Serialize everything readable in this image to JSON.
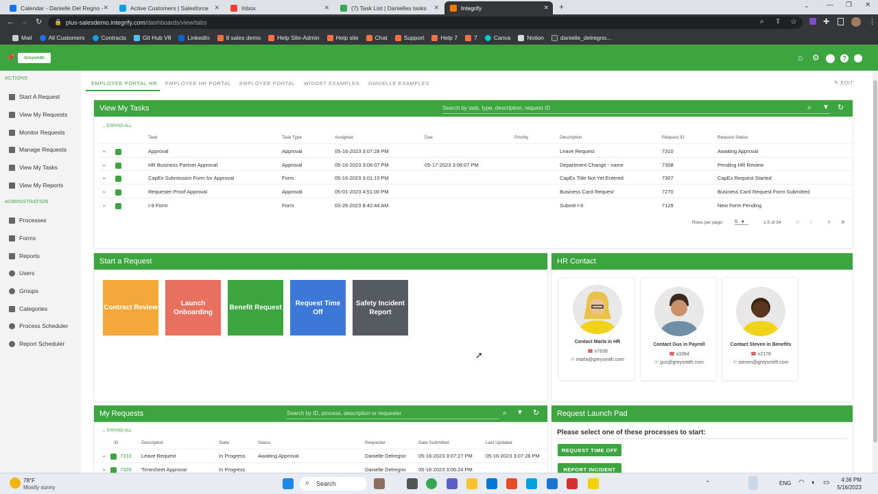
{
  "browser": {
    "tabs": [
      {
        "label": "Calendar - Danielle Del Regno -",
        "color": "#1a73e8"
      },
      {
        "label": "Active Customers | Salesforce",
        "color": "#00a1e0"
      },
      {
        "label": "Inbox",
        "color": "#ea4335"
      },
      {
        "label": "(7) Task List | Danielles tasks",
        "color": "#34a853"
      },
      {
        "label": "Integrify",
        "color": "#f57c00"
      }
    ],
    "url_host": "plus-salesdemo.integrify.com",
    "url_path": "/dashboards/view/tabs",
    "bookmarks": [
      "Mail",
      "All Customers",
      "Contracts",
      "Git Hub V8",
      "LinkedIn",
      "8 sales demo",
      "Help Site-Admin",
      "Help site",
      "Chat",
      "Support",
      "Help 7",
      "7",
      "Canva",
      "Notion",
      "danielle_delregno..."
    ]
  },
  "app": {
    "logo": "Greysmith"
  },
  "sidebar": {
    "actions_heading": "ACTIONS",
    "actions": [
      "Start A Request",
      "View My Requests",
      "Monitor Requests",
      "Manage Requests",
      "View My Tasks",
      "View My Reports"
    ],
    "admin_heading": "ADMINISTRATION",
    "admin": [
      "Processes",
      "Forms",
      "Reports",
      "Users",
      "Groups",
      "Categories",
      "Process Scheduler",
      "Report Scheduler"
    ]
  },
  "portal_tabs": [
    "EMPLOYEE PORTAL HR",
    "EMPLOYEE HR PORTAL",
    "EMPLOYEE PORTAL",
    "WIDGET EXAMPLES",
    "DANIELLE EXAMPLES"
  ],
  "edit_label": "EDIT",
  "tasks": {
    "title": "View My Tasks",
    "search_placeholder": "Search by task, type, description, request ID",
    "expand_all": "EXPAND ALL",
    "columns": [
      "Task",
      "Task Type",
      "Assigned",
      "Due",
      "Priority",
      "Description",
      "Request ID",
      "Request Status"
    ],
    "rows": [
      [
        "Approval",
        "Approval",
        "05-16-2023 3:07:28 PM",
        "",
        "",
        "Leave Request",
        "7310",
        "Awaiting Approval"
      ],
      [
        "HR Business Partner Approval",
        "Approval",
        "05-16-2023 3:06:07 PM",
        "05-17-2023 3:06:07 PM",
        "",
        "Department Change - name",
        "7308",
        "Pending HR Review"
      ],
      [
        "CapEx Submission Form for Approval",
        "Form",
        "05-16-2023 3:01:15 PM",
        "",
        "",
        "CapEx Title Not Yet Entered",
        "7307",
        "CapEx Request Started"
      ],
      [
        "Requester Proof Approval",
        "Approval",
        "05-01-2023 4:51:00 PM",
        "",
        "",
        "Business Card Request",
        "7270",
        "Business Card Request Form Submitted"
      ],
      [
        "I-9 Form",
        "Form",
        "03-26-2023 8:42:44 AM",
        "",
        "",
        "Submit I-9",
        "7129",
        "New Form Pending"
      ]
    ],
    "rows_per_page_label": "Rows per page:",
    "rows_per_page": "5",
    "range": "1-5 of 34"
  },
  "start_request": {
    "title": "Start a Request",
    "tiles": [
      {
        "label": "Contract Review",
        "color": "#f5a83a"
      },
      {
        "label": "Launch Onboarding",
        "color": "#e8705e"
      },
      {
        "label": "Benefit Request",
        "color": "#3da53f"
      },
      {
        "label": "Request Time Off",
        "color": "#3b78d8"
      },
      {
        "label": "Safety Incident Report",
        "color": "#555b61"
      }
    ]
  },
  "hr_contact": {
    "title": "HR Contact",
    "contacts": [
      {
        "name": "Contact Marla in HR",
        "ext": "x7639",
        "email": "marla@greysmith.com"
      },
      {
        "name": "Contact Gus in Payroll",
        "ext": "x3364",
        "email": "gus@greysmith.com"
      },
      {
        "name": "Contact Steven in Benefits",
        "ext": "x2178",
        "email": "steven@greysmith.com"
      }
    ]
  },
  "my_requests": {
    "title": "My Requests",
    "search_placeholder": "Search by ID, process, description or requester",
    "expand_all": "EXPAND ALL",
    "columns": [
      "ID",
      "Description",
      "State",
      "Status",
      "Requester",
      "Date Submitted",
      "Last Updated"
    ],
    "rows": [
      [
        "7310",
        "Leave Request",
        "In Progress",
        "Awaiting Approval",
        "Danielle Delregno",
        "05-16-2023 3:07:27 PM",
        "05-16-2023 3:07:28 PM"
      ],
      [
        "7309",
        "Timesheet Approval",
        "In Progress",
        "",
        "Danielle Delregno",
        "05-16-2023 3:06:24 PM",
        ""
      ]
    ]
  },
  "launch_pad": {
    "title": "Request Launch Pad",
    "prompt": "Please select one of these processes to start:",
    "buttons": [
      "REQUEST TIME OFF",
      "REPORT INCIDENT"
    ]
  },
  "taskbar": {
    "temp": "78°F",
    "weather": "Mostly sunny",
    "search": "Search",
    "lang": "ENG",
    "time": "4:36 PM",
    "date": "5/16/2023"
  }
}
